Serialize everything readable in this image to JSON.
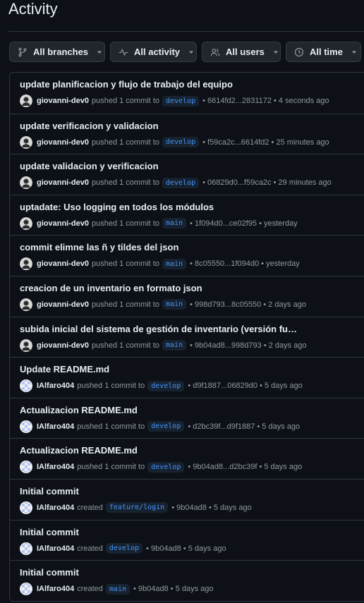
{
  "header": {
    "title": "Activity"
  },
  "filters": [
    {
      "label": "All branches",
      "icon": "branch-icon"
    },
    {
      "label": "All activity",
      "icon": "pulse-icon"
    },
    {
      "label": "All users",
      "icon": "people-icon"
    },
    {
      "label": "All time",
      "icon": "clock-icon"
    }
  ],
  "activity": [
    {
      "title": "update planificacion y flujo de trabajo del equipo",
      "user": "giovanni-dev0",
      "action": "pushed 1 commit to",
      "branch": "develop",
      "detail": "• 6614fd2...2831172 • 4 seconds ago",
      "avatar": "photo"
    },
    {
      "title": "update verificacion y validacion",
      "user": "giovanni-dev0",
      "action": "pushed 1 commit to",
      "branch": "develop",
      "detail": "• f59ca2c...6614fd2 • 25 minutes ago",
      "avatar": "photo"
    },
    {
      "title": "update validacion y verificacion",
      "user": "giovanni-dev0",
      "action": "pushed 1 commit to",
      "branch": "develop",
      "detail": "• 06829d0...f59ca2c • 29 minutes ago",
      "avatar": "photo"
    },
    {
      "title": "uptadate: Uso logging en todos los módulos",
      "user": "giovanni-dev0",
      "action": "pushed 1 commit to",
      "branch": "main",
      "detail": "• 1f094d0...ce02f95 • yesterday",
      "avatar": "photo"
    },
    {
      "title": "commit elimne las ñ y tildes del json",
      "user": "giovanni-dev0",
      "action": "pushed 1 commit to",
      "branch": "main",
      "detail": "• 8c05550...1f094d0 • yesterday",
      "avatar": "photo"
    },
    {
      "title": "creacion de un inventario en formato json",
      "user": "giovanni-dev0",
      "action": "pushed 1 commit to",
      "branch": "main",
      "detail": "• 998d793...8c05550 • 2 days ago",
      "avatar": "photo"
    },
    {
      "title": "subida inicial del sistema de gestión de inventario (versión funcion...",
      "user": "giovanni-dev0",
      "action": "pushed 1 commit to",
      "branch": "main",
      "detail": "• 9b04ad8...998d793 • 2 days ago",
      "avatar": "photo"
    },
    {
      "title": "Update README.md",
      "user": "IAlfaro404",
      "action": "pushed 1 commit to",
      "branch": "develop",
      "detail": "• d9f1887...06829d0 • 5 days ago",
      "avatar": "identicon"
    },
    {
      "title": "Actualizacion README.md",
      "user": "IAlfaro404",
      "action": "pushed 1 commit to",
      "branch": "develop",
      "detail": "• d2bc39f...d9f1887 • 5 days ago",
      "avatar": "identicon"
    },
    {
      "title": "Actualizacion README.md",
      "user": "IAlfaro404",
      "action": "pushed 1 commit to",
      "branch": "develop",
      "detail": "• 9b04ad8...d2bc39f • 5 days ago",
      "avatar": "identicon"
    },
    {
      "title": "Initial commit",
      "user": "IAlfaro404",
      "action": "created",
      "branch": "feature/login",
      "detail": "• 9b04ad8 • 5 days ago",
      "avatar": "identicon"
    },
    {
      "title": "Initial commit",
      "user": "IAlfaro404",
      "action": "created",
      "branch": "develop",
      "detail": "• 9b04ad8 • 5 days ago",
      "avatar": "identicon"
    },
    {
      "title": "Initial commit",
      "user": "IAlfaro404",
      "action": "created",
      "branch": "main",
      "detail": "• 9b04ad8 • 5 days ago",
      "avatar": "identicon"
    }
  ],
  "colors": {
    "background": "#0d1117",
    "border": "#30363d",
    "branch_text": "#4493f8",
    "identicon": "#b6c7f5"
  }
}
